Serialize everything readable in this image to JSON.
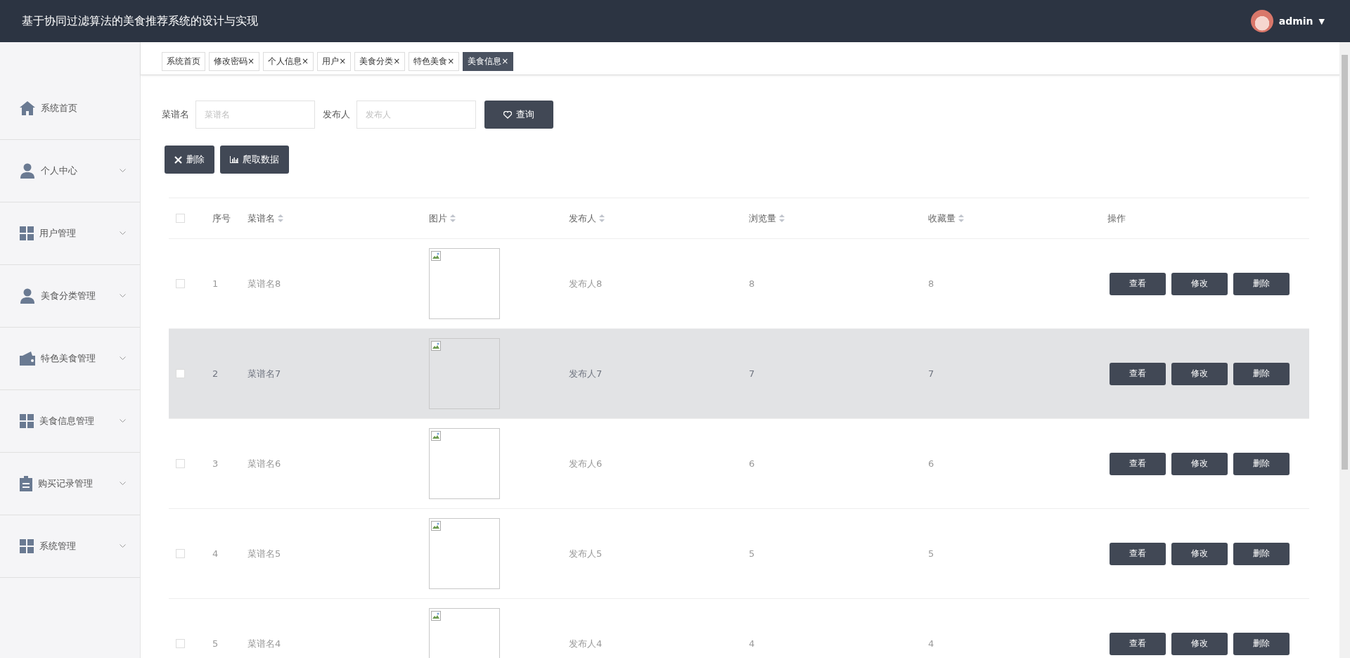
{
  "header": {
    "title": "基于协同过滤算法的美食推荐系统的设计与实现",
    "user": "admin",
    "menu_caret": "▼"
  },
  "sidebar": {
    "items": [
      {
        "label": "系统首页",
        "kind": "home",
        "expandable": false
      },
      {
        "label": "个人中心",
        "kind": "person",
        "expandable": true
      },
      {
        "label": "用户管理",
        "kind": "grid",
        "expandable": true
      },
      {
        "label": "美食分类管理",
        "kind": "person",
        "expandable": true
      },
      {
        "label": "特色美食管理",
        "kind": "wallet",
        "expandable": true
      },
      {
        "label": "美食信息管理",
        "kind": "grid",
        "expandable": true
      },
      {
        "label": "购买记录管理",
        "kind": "clipboard",
        "expandable": true
      },
      {
        "label": "系统管理",
        "kind": "grid",
        "expandable": true
      }
    ]
  },
  "tabs": [
    {
      "label": "系统首页",
      "selected": false
    },
    {
      "label": "修改密码",
      "close": "×",
      "selected": false
    },
    {
      "label": "个人信息",
      "close": "×",
      "selected": false
    },
    {
      "label": "用户",
      "close": "×",
      "selected": false
    },
    {
      "label": "美食分类",
      "close": "×",
      "selected": false
    },
    {
      "label": "特色美食",
      "close": "×",
      "selected": false
    },
    {
      "label": "美食信息",
      "close": "×",
      "selected": true
    }
  ],
  "search": {
    "fields": [
      {
        "label": "菜谱名",
        "placeholder": "菜谱名"
      },
      {
        "label": "发布人",
        "placeholder": "发布人"
      }
    ],
    "button": "查询"
  },
  "actions": [
    {
      "label": "删除",
      "kind": "delete"
    },
    {
      "label": "爬取数据",
      "kind": "crawl"
    }
  ],
  "table": {
    "select_all_checked": false,
    "columns": [
      {
        "label": "序号",
        "sortable": false
      },
      {
        "label": "菜谱名",
        "sortable": true
      },
      {
        "label": "图片",
        "sortable": true
      },
      {
        "label": "发布人",
        "sortable": true
      },
      {
        "label": "浏览量",
        "sortable": true
      },
      {
        "label": "收藏量",
        "sortable": true
      },
      {
        "label": "操作",
        "sortable": false
      }
    ],
    "rows": [
      {
        "index": "1",
        "name": "菜谱名8",
        "publisher": "发布人8",
        "views": "8",
        "favorites": "8",
        "checked": false,
        "highlighted": false,
        "buttons": [
          "查看",
          "修改",
          "删除"
        ]
      },
      {
        "index": "2",
        "name": "菜谱名7",
        "publisher": "发布人7",
        "views": "7",
        "favorites": "7",
        "checked": false,
        "highlighted": true,
        "buttons": [
          "查看",
          "修改",
          "删除"
        ]
      },
      {
        "index": "3",
        "name": "菜谱名6",
        "publisher": "发布人6",
        "views": "6",
        "favorites": "6",
        "checked": false,
        "highlighted": false,
        "buttons": [
          "查看",
          "修改",
          "删除"
        ]
      },
      {
        "index": "4",
        "name": "菜谱名5",
        "publisher": "发布人5",
        "views": "5",
        "favorites": "5",
        "checked": false,
        "highlighted": false,
        "buttons": [
          "查看",
          "修改",
          "删除"
        ]
      },
      {
        "index": "5",
        "name": "菜谱名4",
        "publisher": "发布人4",
        "views": "4",
        "favorites": "4",
        "checked": false,
        "highlighted": false,
        "buttons": [
          "查看",
          "修改",
          "删除"
        ]
      }
    ]
  }
}
